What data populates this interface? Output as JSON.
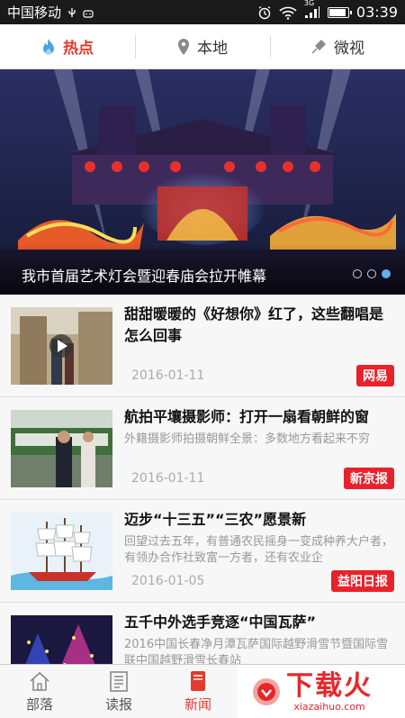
{
  "status_bar": {
    "carrier": "中国移动",
    "signal_badge": "3G",
    "time": "03:39"
  },
  "tabs": [
    {
      "label": "热点",
      "icon": "flame-icon",
      "active": true
    },
    {
      "label": "本地",
      "icon": "location-pin-icon",
      "active": false
    },
    {
      "label": "微视",
      "icon": "video-icon",
      "active": false
    }
  ],
  "banner": {
    "caption": "我市首届艺术灯会暨迎春庙会拉开帷幕",
    "page_count": 3,
    "active_page": 3
  },
  "news": [
    {
      "title": "甜甜暖暖的《好想你》红了，这些翻唱是怎么回事",
      "summary": "",
      "date": "2016-01-11",
      "source": "网易",
      "has_video": true
    },
    {
      "title": "航拍平壤摄影师：打开一扇看朝鲜的窗",
      "summary": "外籍摄影师拍摄朝鲜全景：多数地方看起来不穷",
      "date": "2016-01-11",
      "source": "新京报",
      "has_video": false
    },
    {
      "title": "迈步“十三五”“三农”愿景新",
      "summary": "回望过去五年，有普通农民摇身一变成种养大户者，有领办合作社致富一方者，还有农业企",
      "date": "2016-01-05",
      "source": "益阳日报",
      "has_video": false
    },
    {
      "title": "五千中外选手竞逐“中国瓦萨”",
      "summary": "2016中国长春净月潭瓦萨国际越野滑雪节暨国际雪联中国越野滑雪长春站",
      "date": "",
      "source": "",
      "has_video": false
    }
  ],
  "bottom_nav": [
    {
      "label": "部落",
      "icon": "home-icon",
      "active": false
    },
    {
      "label": "读报",
      "icon": "newspaper-icon",
      "active": false
    },
    {
      "label": "新闻",
      "icon": "news-icon",
      "active": true
    }
  ],
  "promo": {
    "main": "下载火",
    "sub": "xiazaihuo.com"
  },
  "colors": {
    "accent": "#e23b2e",
    "source_badge": "#e8222a",
    "dot_active": "#5fb1e8"
  }
}
